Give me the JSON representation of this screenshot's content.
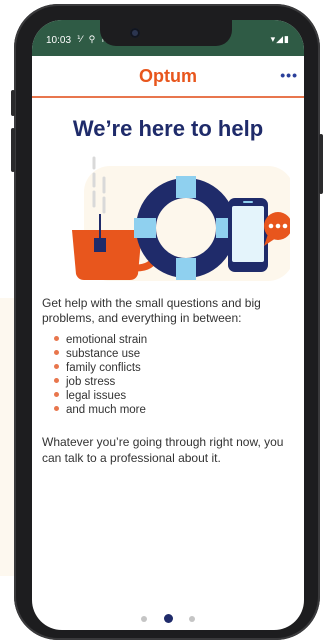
{
  "status_bar": {
    "time": "10:03",
    "left_icons": "⅟ ⚲ M",
    "right_icons": "▾◢▮"
  },
  "app_bar": {
    "logo": "Optum",
    "more_icon": "•••"
  },
  "content": {
    "headline": "We’re here to help",
    "intro": "Get help with the small questions and big problems, and everything in between:",
    "bullets": [
      "emotional strain",
      "substance use",
      "family conflicts",
      "job stress",
      "legal issues",
      "and much more"
    ],
    "outro": "Whatever you’re going through right now, you can talk to a professional about it."
  },
  "pager": {
    "page_count": 3,
    "active_index": 1
  },
  "colors": {
    "status_bar": "#2f5b45",
    "brand_orange": "#e8561d",
    "navy": "#1f2b6a",
    "life_ring_blue": "#8fd0ef",
    "accent_line": "#e8764d"
  },
  "icons": {
    "illustration": "tea-mug-life-ring-phone-chat-icon",
    "more": "more-dots-icon"
  }
}
